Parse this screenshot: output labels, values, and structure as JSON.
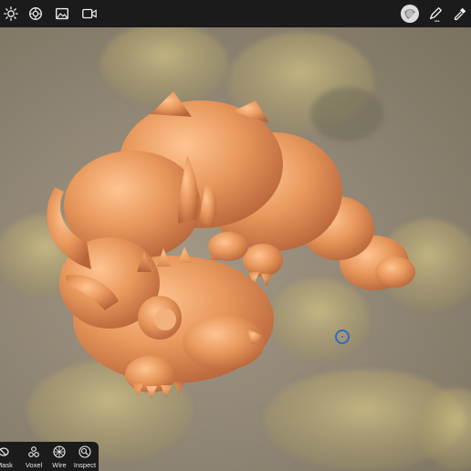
{
  "toolbar": {
    "left_icons": [
      "light-icon",
      "material-icon",
      "image-icon",
      "video-icon"
    ],
    "right_icons": [
      "brush-preview-icon",
      "pen-icon",
      "eyedropper-icon"
    ]
  },
  "bottom_tools": {
    "mask_label": "Mask",
    "voxel_label": "Voxel",
    "wire_label": "Wire",
    "inspect_label": "Inspect"
  },
  "colors": {
    "clay": "#e39a62",
    "pivot": "#2f68c9",
    "toolbar": "#1b1b1b"
  }
}
